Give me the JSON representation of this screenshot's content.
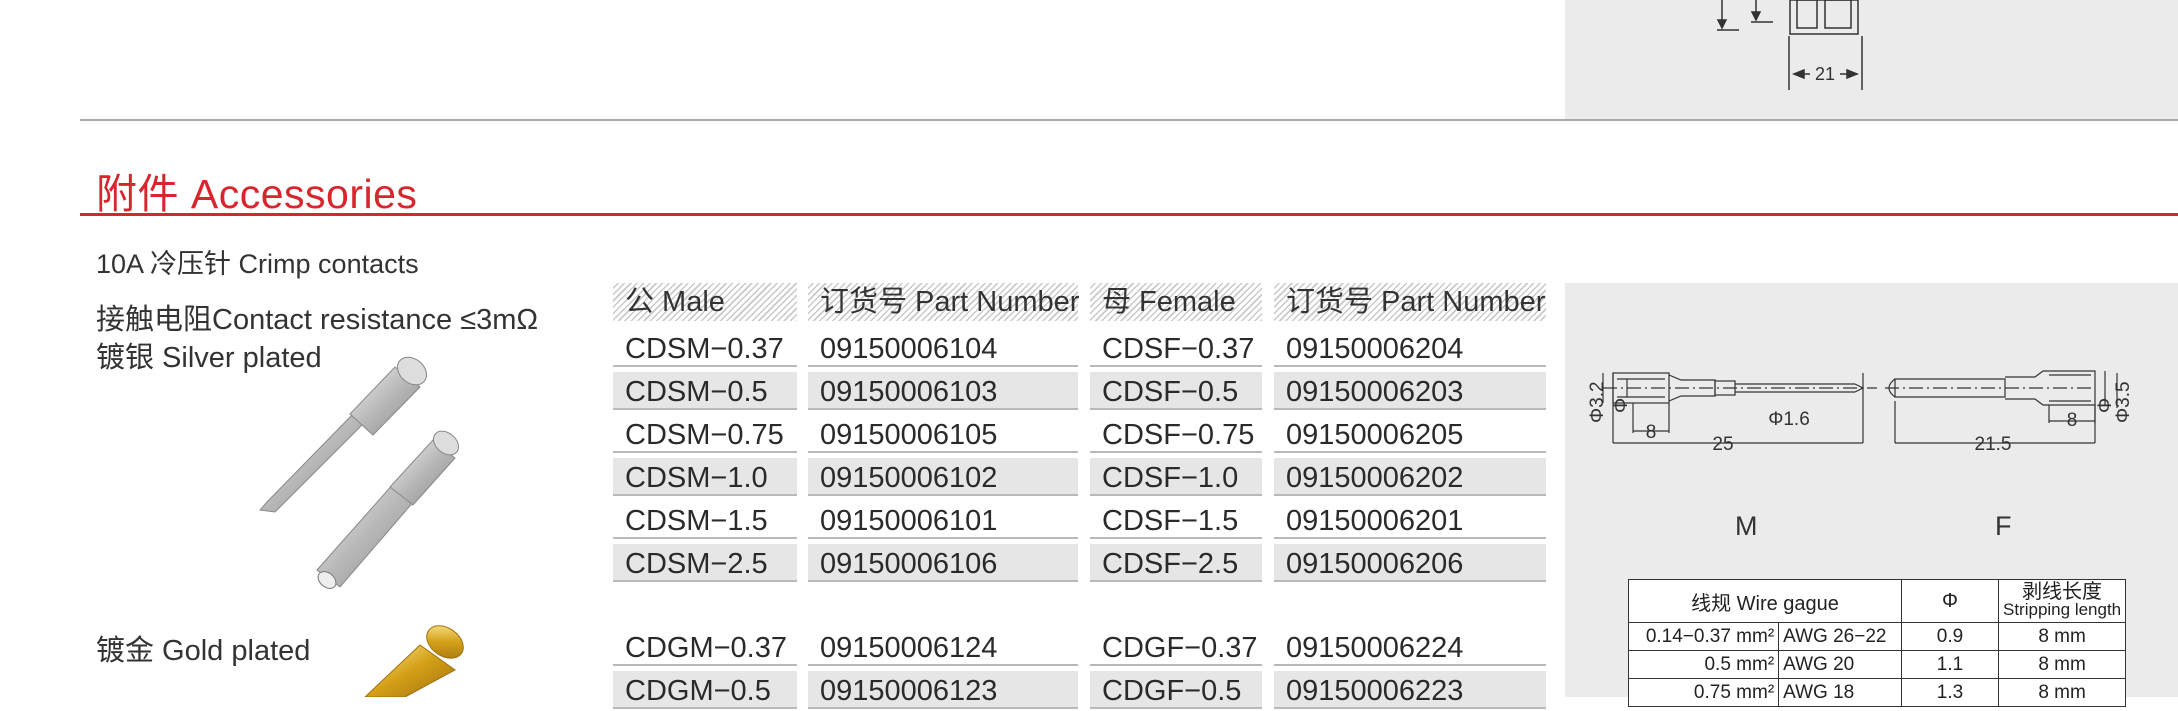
{
  "top_drawing": {
    "dimension_label": "21"
  },
  "section": {
    "title_cn": "附件",
    "title_en": "Accessories"
  },
  "subsection": "10A 冷压针 Crimp contacts",
  "notes": {
    "contact_resistance": "接触电阻Contact resistance ≤3mΩ",
    "silver": "镀银 Silver plated",
    "gold": "镀金 Gold plated"
  },
  "table": {
    "headers": [
      "公 Male",
      "订货号 Part Number",
      "母 Female",
      "订货号 Part Number"
    ],
    "silver_rows": [
      [
        "CDSM−0.37",
        "09150006104",
        "CDSF−0.37",
        "09150006204"
      ],
      [
        "CDSM−0.5",
        "09150006103",
        "CDSF−0.5",
        "09150006203"
      ],
      [
        "CDSM−0.75",
        "09150006105",
        "CDSF−0.75",
        "09150006205"
      ],
      [
        "CDSM−1.0",
        "09150006102",
        "CDSF−1.0",
        "09150006202"
      ],
      [
        "CDSM−1.5",
        "09150006101",
        "CDSF−1.5",
        "09150006201"
      ],
      [
        "CDSM−2.5",
        "09150006106",
        "CDSF−2.5",
        "09150006206"
      ]
    ],
    "gold_rows": [
      [
        "CDGM−0.37",
        "09150006124",
        "CDGF−0.37",
        "09150006224"
      ],
      [
        "CDGM−0.5",
        "09150006123",
        "CDGF−0.5",
        "09150006223"
      ]
    ]
  },
  "drawing": {
    "male_label": "M",
    "female_label": "F",
    "male_dims": {
      "dia_outer": "Φ3.2",
      "dia_mark": "Φ",
      "len_8": "8",
      "len_25": "25",
      "pin_dia": "Φ1.6"
    },
    "female_dims": {
      "len_8": "8",
      "len_21_5": "21.5",
      "dia_mark": "Φ",
      "dia_outer": "Φ3.5"
    }
  },
  "wire_table": {
    "headers": [
      "线规 Wire gague",
      "Φ",
      "剥线长度",
      "Stripping length"
    ],
    "rows": [
      [
        "0.14−0.37 mm²",
        "AWG 26−22",
        "0.9",
        "8 mm"
      ],
      [
        "0.5 mm²",
        "AWG 20",
        "1.1",
        "8 mm"
      ],
      [
        "0.75 mm²",
        "AWG 18",
        "1.3",
        "8 mm"
      ]
    ]
  },
  "colors": {
    "accent": "#d8262e",
    "panel": "#ebebeb",
    "row_shade": "#e6e6e6",
    "gold": "#d4a017",
    "silver": "#c8c8c8"
  }
}
